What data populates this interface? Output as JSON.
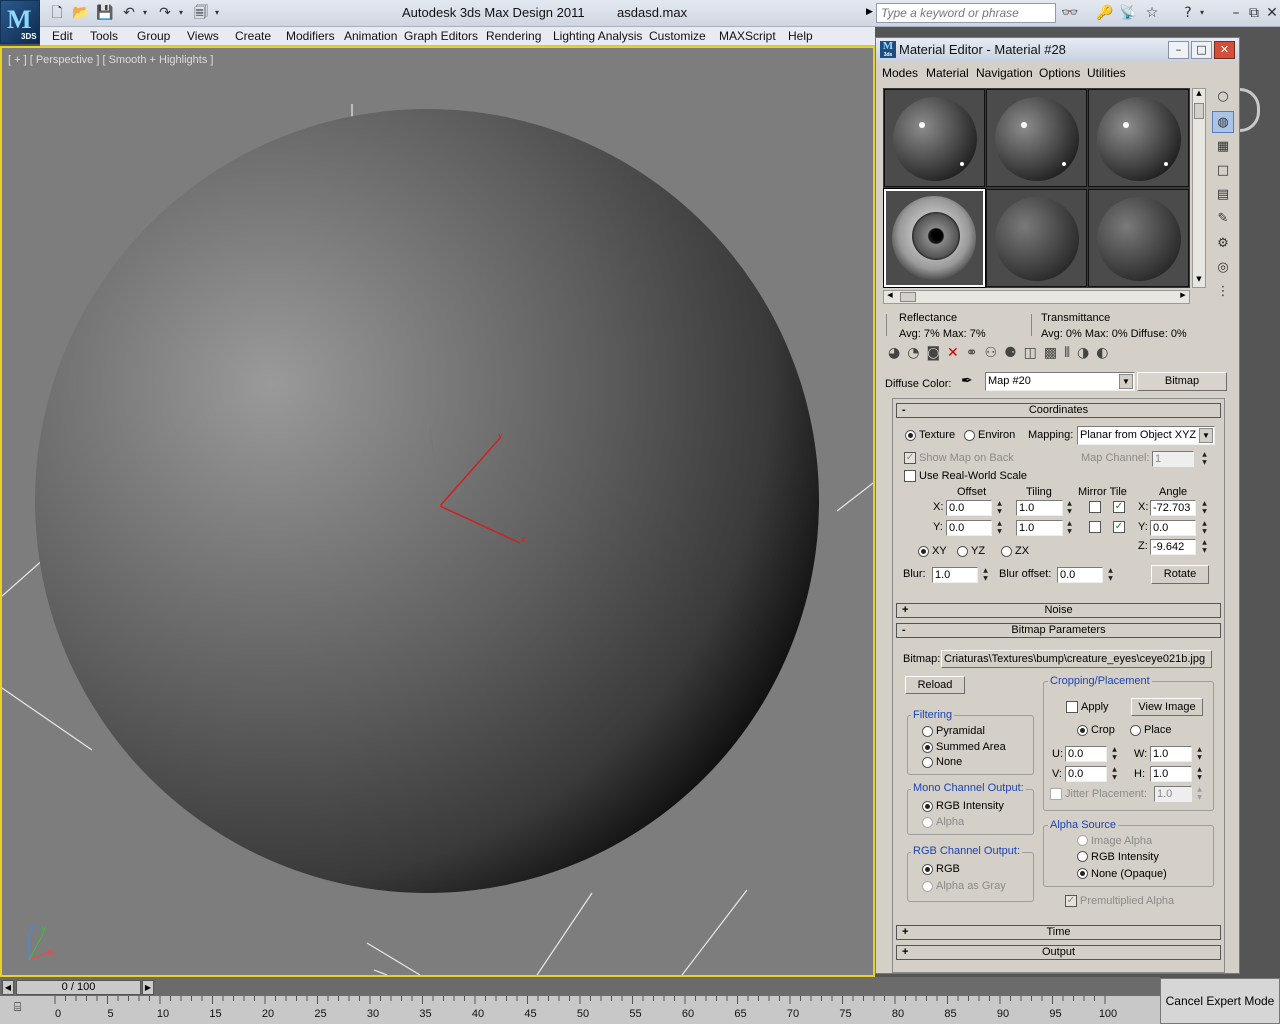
{
  "titlebar": {
    "app_title": "Autodesk 3ds Max Design 2011",
    "file_name": "asdasd.max",
    "logo_text": "3DS",
    "search_placeholder": "Type a keyword or phrase"
  },
  "menubar": {
    "items": [
      "Edit",
      "Tools",
      "Group",
      "Views",
      "Create",
      "Modifiers",
      "Animation",
      "Graph Editors",
      "Rendering",
      "Lighting Analysis",
      "Customize",
      "MAXScript",
      "Help"
    ]
  },
  "viewport": {
    "label": "[ + ] [ Perspective ] [ Smooth + Highlights ]",
    "axis_labels": {
      "z": "z",
      "y": "y",
      "x": "x"
    }
  },
  "material_editor": {
    "title": "Material Editor - Material #28",
    "icon_label": "3ds",
    "menu": [
      "Modes",
      "Material",
      "Navigation",
      "Options",
      "Utilities"
    ],
    "reflectance": {
      "label": "Reflectance",
      "stats": "Avg:   7% Max:   7%"
    },
    "transmittance": {
      "label": "Transmittance",
      "stats": "Avg:   0% Max:   0%  Diffuse:   0%"
    },
    "diffuse_label": "Diffuse Color:",
    "map_name": "Map #20",
    "map_type": "Bitmap",
    "coordinates": {
      "header": "Coordinates",
      "texture": "Texture",
      "environ": "Environ",
      "mapping_label": "Mapping:",
      "mapping_value": "Planar from Object XYZ",
      "show_map_on_back": "Show Map on Back",
      "map_channel_label": "Map Channel:",
      "map_channel_value": "1",
      "real_world": "Use Real-World Scale",
      "offset": "Offset",
      "tiling": "Tiling",
      "mirror_tile": "Mirror Tile",
      "angle": "Angle",
      "x_label": "X:",
      "y_label": "Y:",
      "z_label": "Z:",
      "offset_x": "0.0",
      "offset_y": "0.0",
      "tiling_x": "1.0",
      "tiling_y": "1.0",
      "angle_x": "-72.703",
      "angle_y": "0.0",
      "angle_z": "-9.642",
      "xy": "XY",
      "yz": "YZ",
      "zx": "ZX",
      "blur_label": "Blur:",
      "blur_value": "1.0",
      "blur_offset_label": "Blur offset:",
      "blur_offset_value": "0.0",
      "rotate": "Rotate"
    },
    "noise_header": "Noise",
    "bitmap_params": {
      "header": "Bitmap Parameters",
      "bitmap_label": "Bitmap:",
      "bitmap_path": "Criaturas\\Textures\\bump\\creature_eyes\\ceye021b.jpg",
      "reload": "Reload",
      "filtering": "Filtering",
      "pyramidal": "Pyramidal",
      "summed_area": "Summed Area",
      "none": "None",
      "mono_output": "Mono Channel Output:",
      "rgb_intensity": "RGB Intensity",
      "alpha": "Alpha",
      "rgb_output": "RGB Channel Output:",
      "rgb": "RGB",
      "alpha_as_gray": "Alpha as Gray",
      "cropping": "Cropping/Placement",
      "apply": "Apply",
      "view_image": "View Image",
      "crop": "Crop",
      "place": "Place",
      "u_label": "U:",
      "v_label": "V:",
      "w_label": "W:",
      "h_label": "H:",
      "u": "0.0",
      "v": "0.0",
      "w": "1.0",
      "h": "1.0",
      "jitter": "Jitter Placement:",
      "jitter_value": "1.0",
      "alpha_source": "Alpha Source",
      "image_alpha": "Image Alpha",
      "rgb_intensity2": "RGB Intensity",
      "none_opaque": "None (Opaque)",
      "premultiplied": "Premultiplied Alpha"
    },
    "time_header": "Time",
    "output_header": "Output"
  },
  "timeline": {
    "slider": "0 / 100",
    "ticks": [
      "0",
      "5",
      "10",
      "15",
      "20",
      "25",
      "30",
      "35",
      "40",
      "45",
      "50",
      "55",
      "60",
      "65",
      "70",
      "75",
      "80",
      "85",
      "90",
      "95",
      "100"
    ],
    "cancel_expert": "Cancel Expert Mode"
  }
}
